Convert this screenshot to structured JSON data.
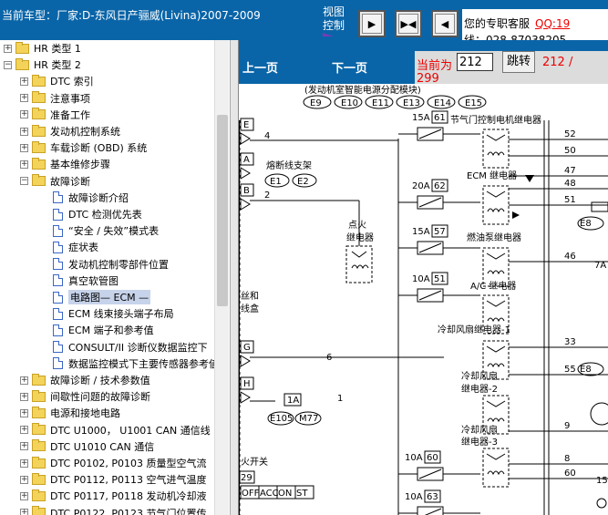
{
  "header": {
    "vehicle": "当前车型：厂家:D-东风日产骊威(Livina)2007-2009",
    "view_control_line1": "视图",
    "view_control_line2": "控制",
    "service_text": "您的专职客服",
    "service_qq": "QQ:19",
    "service_phone": "线：028-87038205"
  },
  "toolbar": {
    "btn_next": "▶",
    "btn_fit": "▶◀",
    "btn_prev": "◀"
  },
  "tree": {
    "items": [
      {
        "label": "HR 类型 1",
        "kind": "folder",
        "expander": "+"
      },
      {
        "label": "HR 类型 2",
        "kind": "folder",
        "expander": "−"
      },
      {
        "label": "DTC 索引",
        "kind": "folder",
        "expander": "+"
      },
      {
        "label": "注意事项",
        "kind": "folder",
        "expander": "+"
      },
      {
        "label": "准备工作",
        "kind": "folder",
        "expander": "+"
      },
      {
        "label": "发动机控制系统",
        "kind": "folder",
        "expander": "+"
      },
      {
        "label": "车载诊断 (OBD) 系统",
        "kind": "folder",
        "expander": "+"
      },
      {
        "label": "基本维修步骤",
        "kind": "folder",
        "expander": "+"
      },
      {
        "label": "故障诊断",
        "kind": "folder",
        "expander": "−"
      },
      {
        "label": "故障诊断介绍",
        "kind": "doc"
      },
      {
        "label": "DTC 检测优先表",
        "kind": "doc"
      },
      {
        "label": "“安全 / 失效”模式表",
        "kind": "doc"
      },
      {
        "label": "症状表",
        "kind": "doc"
      },
      {
        "label": "发动机控制零部件位置",
        "kind": "doc"
      },
      {
        "label": "真空软管图",
        "kind": "doc"
      },
      {
        "label": "电路图— ECM —",
        "kind": "doc",
        "selected": true
      },
      {
        "label": "ECM 线束接头端子布局",
        "kind": "doc"
      },
      {
        "label": "ECM 端子和参考值",
        "kind": "doc"
      },
      {
        "label": "CONSULT/II 诊断仪数据监控下",
        "kind": "doc"
      },
      {
        "label": "数据监控模式下主要传感器参考値",
        "kind": "doc"
      },
      {
        "label": "故障诊断 / 技术参数值",
        "kind": "folder",
        "expander": "+"
      },
      {
        "label": "间歇性问题的故障诊断",
        "kind": "folder",
        "expander": "+"
      },
      {
        "label": "电源和接地电路",
        "kind": "folder",
        "expander": "+"
      },
      {
        "label": "DTC U1000， U1001 CAN 通信线",
        "kind": "folder",
        "expander": "+"
      },
      {
        "label": "DTC U1010 CAN 通信",
        "kind": "folder",
        "expander": "+"
      },
      {
        "label": "DTC P0102, P0103 质量型空气流",
        "kind": "folder",
        "expander": "+"
      },
      {
        "label": "DTC P0112, P0113 空气进气温度",
        "kind": "folder",
        "expander": "+"
      },
      {
        "label": "DTC P0117, P0118 发动机冷却液",
        "kind": "folder",
        "expander": "+"
      },
      {
        "label": "DTC P0122, P0123 节气门位置传",
        "kind": "folder",
        "expander": "+"
      }
    ]
  },
  "pager": {
    "prev": "上一页",
    "next": "下一页",
    "current_label": "当前为",
    "current_value": "212",
    "go": "跳转",
    "total_a": "212 /",
    "total_b": "299"
  },
  "diagram": {
    "top_caption": "(发动机室智能电源分配模块)",
    "connectors_top": [
      "E9",
      "E10",
      "E11",
      "E13",
      "E14",
      "E15"
    ],
    "fuse_block_label": "熔断线支架",
    "fuse_block_conns": [
      "E1",
      "E2"
    ],
    "ignition_relay_label_1": "点火",
    "ignition_relay_label_2": "继电器",
    "throttle_relay": "节气门控制电机继电器",
    "ecm_relay": "ECM 继电器",
    "fuel_pump_relay": "燃油泵继电器",
    "ac_relay": "A/C 继电器",
    "fan_relay_1": "冷却风扇继电器-1",
    "fan_relay_2a": "冷却风扇",
    "fan_relay_2b": "继电器-2",
    "fan_relay_3a": "冷却风扇",
    "fan_relay_3b": "继电器-3",
    "left_label_1": "丝和",
    "left_label_2": "线盒",
    "ign_switch": "火开关",
    "switch_positions": [
      "OFF",
      "ACC",
      "ON",
      "ST"
    ],
    "fuses": [
      {
        "amp": "15A",
        "no": "61"
      },
      {
        "amp": "20A",
        "no": "62"
      },
      {
        "amp": "15A",
        "no": "57"
      },
      {
        "amp": "10A",
        "no": "51"
      },
      {
        "amp": "10A",
        "no": "60"
      },
      {
        "amp": "10A",
        "no": "63"
      }
    ],
    "box_letters": [
      "E",
      "A",
      "B",
      "G",
      "H"
    ],
    "wire_numbers_left": [
      "4",
      "2",
      "6",
      "1"
    ],
    "wire_numbers_right": [
      "52",
      "50",
      "47",
      "48",
      "51",
      "46",
      "33",
      "55",
      "9",
      "8",
      "60"
    ],
    "fuse_1a": "1A",
    "conn_e105": "E105",
    "conn_m77": "M77",
    "conn_29": "29",
    "right_edge_conns": [
      "E8",
      "7A",
      "E8",
      "15"
    ]
  }
}
